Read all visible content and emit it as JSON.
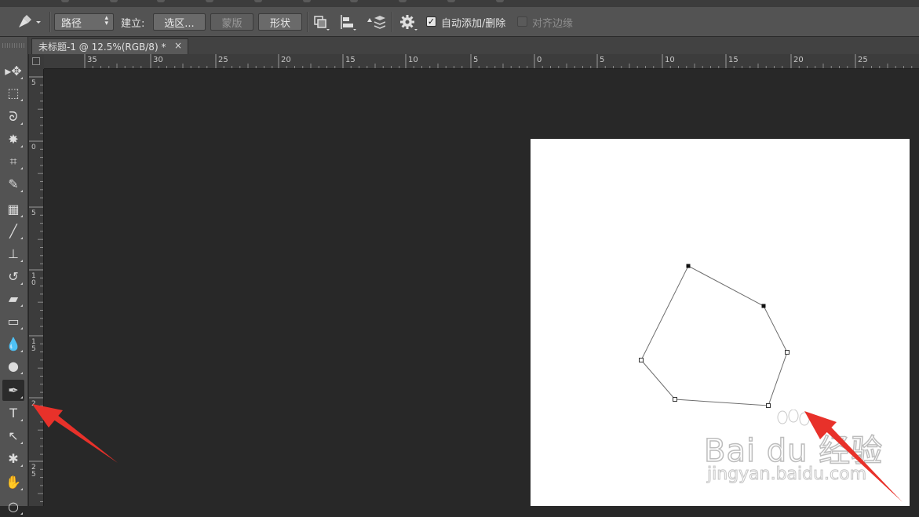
{
  "options_bar": {
    "tool_mode": "路径",
    "make_label": "建立:",
    "selection_button": "选区...",
    "mask_button": "蒙版",
    "shape_button": "形状",
    "auto_add_delete_label": "自动添加/删除",
    "auto_add_delete_checked": true,
    "align_edges_label": "对齐边缘",
    "align_edges_checked": false
  },
  "document_tab": {
    "title": "未标题-1 @ 12.5%(RGB/8) *",
    "close": "×"
  },
  "rulers": {
    "horizontal_labels": [
      "35",
      "30",
      "25",
      "20",
      "15",
      "10",
      "5",
      "0",
      "5",
      "10",
      "15",
      "20",
      "25"
    ],
    "vertical_labels": [
      "5",
      "0",
      "5",
      "1\n0",
      "1\n5",
      "2",
      "2\n5"
    ]
  },
  "toolbar": {
    "tools": [
      {
        "name": "move-tool",
        "glyph": "▸✥"
      },
      {
        "name": "marquee-tool",
        "glyph": "⬚"
      },
      {
        "name": "lasso-tool",
        "glyph": "ᘐ"
      },
      {
        "name": "magic-wand-tool",
        "glyph": "✸"
      },
      {
        "name": "crop-tool",
        "glyph": "⌗"
      },
      {
        "name": "eyedropper-tool",
        "glyph": "✎"
      },
      {
        "name": "healing-brush-tool",
        "glyph": "▦"
      },
      {
        "name": "brush-tool",
        "glyph": "╱"
      },
      {
        "name": "clone-stamp-tool",
        "glyph": "⊥"
      },
      {
        "name": "history-brush-tool",
        "glyph": "↺"
      },
      {
        "name": "eraser-tool",
        "glyph": "▰"
      },
      {
        "name": "gradient-tool",
        "glyph": "▭"
      },
      {
        "name": "blur-tool",
        "glyph": "💧"
      },
      {
        "name": "dodge-tool",
        "glyph": "●"
      },
      {
        "name": "pen-tool",
        "glyph": "✒"
      },
      {
        "name": "type-tool",
        "glyph": "T"
      },
      {
        "name": "path-selection-tool",
        "glyph": "↖"
      },
      {
        "name": "custom-shape-tool",
        "glyph": "✱"
      },
      {
        "name": "hand-tool",
        "glyph": "✋"
      },
      {
        "name": "zoom-tool",
        "glyph": "○"
      }
    ],
    "active_tool": "pen-tool"
  },
  "watermark": {
    "logo_text": "Bai du 经验",
    "url": "jingyan.baidu.com"
  },
  "colors": {
    "workspace": "#282828",
    "panel": "#535353",
    "document": "#ffffff",
    "annotation_arrow": "#e8312a"
  }
}
